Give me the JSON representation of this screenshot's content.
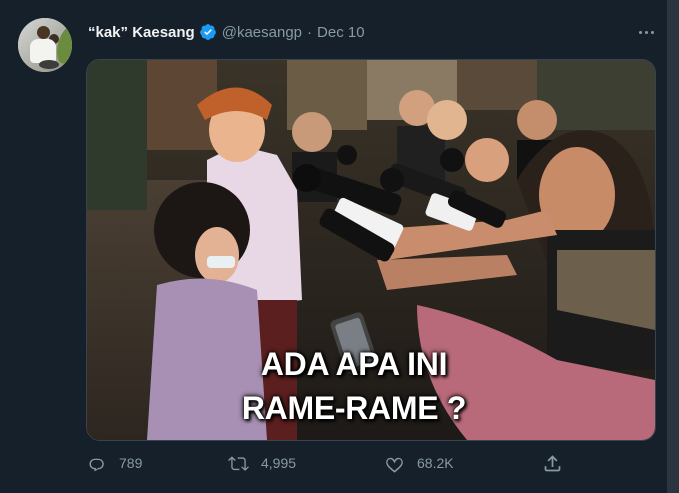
{
  "tweet": {
    "display_name": "“kak” Kaesang",
    "handle": "@kaesangp",
    "separator": "·",
    "date": "Dec 10",
    "verified": true,
    "more_icon": "more-horizontal-icon"
  },
  "media": {
    "caption_line1": "ADA APA INI",
    "caption_line2": "RAME-RAME ?",
    "mic_labels": [
      "iNews",
      "TV"
    ]
  },
  "actions": {
    "replies": "789",
    "retweets": "4,995",
    "likes": "68.2K",
    "reply_icon": "reply-icon",
    "retweet_icon": "retweet-icon",
    "like_icon": "heart-icon",
    "share_icon": "share-icon"
  },
  "colors": {
    "background": "#15202b",
    "secondary_text": "#8899a6",
    "verified_blue": "#1d9bf0"
  }
}
